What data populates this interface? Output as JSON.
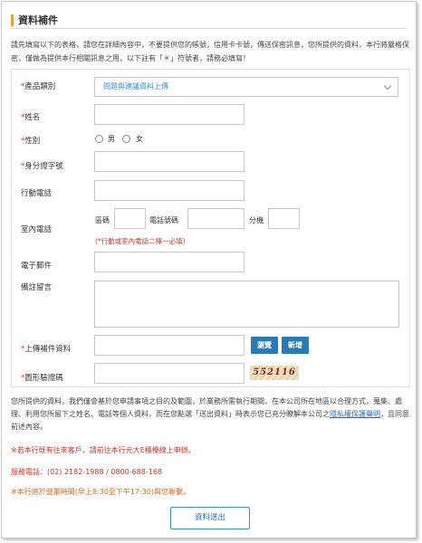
{
  "page": {
    "title": "資料補件",
    "intro": "請先填寫以下的表格，請您在詳細內容中，不要提供您的帳號，信用卡卡號，傳送保密訊息，您所提供的資料，本行將嚴格保密，僅做為提供本行相關訊息之用，以下註有「＊」符號者，請務必填寫！"
  },
  "form": {
    "product_type": {
      "label": "產品類別",
      "value": "問題與建議資料上傳"
    },
    "name": {
      "label": "姓名"
    },
    "gender": {
      "label": "性別",
      "option_male": "男",
      "option_female": "女"
    },
    "id_number": {
      "label": "身分證字號"
    },
    "mobile": {
      "label": "行動電話"
    },
    "landline": {
      "label": "室內電話",
      "area_code": "區碼",
      "phone_number": "電話號碼",
      "extension": "分機",
      "note": "(*行動或室內電話二擇一必填)"
    },
    "email": {
      "label": "電子郵件"
    },
    "remarks": {
      "label": "備註留言"
    },
    "upload": {
      "label": "上傳補件資料",
      "browse": "瀏覽",
      "add": "新增"
    },
    "captcha": {
      "label": "圖形驗證碼",
      "image_text": "552116"
    },
    "required_mark": "*"
  },
  "footer": {
    "privacy_text_1": "您所提供的資料，我們僅會基於您申請事項之目的及範圍，於業務所需執行期間，在本公司所在地區以合理方式，蒐集、處理、利用您所留下之姓名、電話等個人資料，而在您點選「送出資料」時表示您已充分瞭解本公司之",
    "privacy_link": "隱私權保護聲明",
    "privacy_text_2": "，且同意前述內容。",
    "non_customer": "※若本行既有往來客戶，請前往本行元大E櫃檯線上申辦。",
    "service_phone": "服務電話：(02) 2182-1988 / 0800-688-168",
    "business_hours": "※本行將於營業時間(早上8:30至下午17:30)與您聯繫。",
    "submit_label": "資料送出"
  },
  "colors": {
    "accent": "#e8a23c",
    "primary": "#2a7ab8",
    "required": "#c0392b"
  }
}
